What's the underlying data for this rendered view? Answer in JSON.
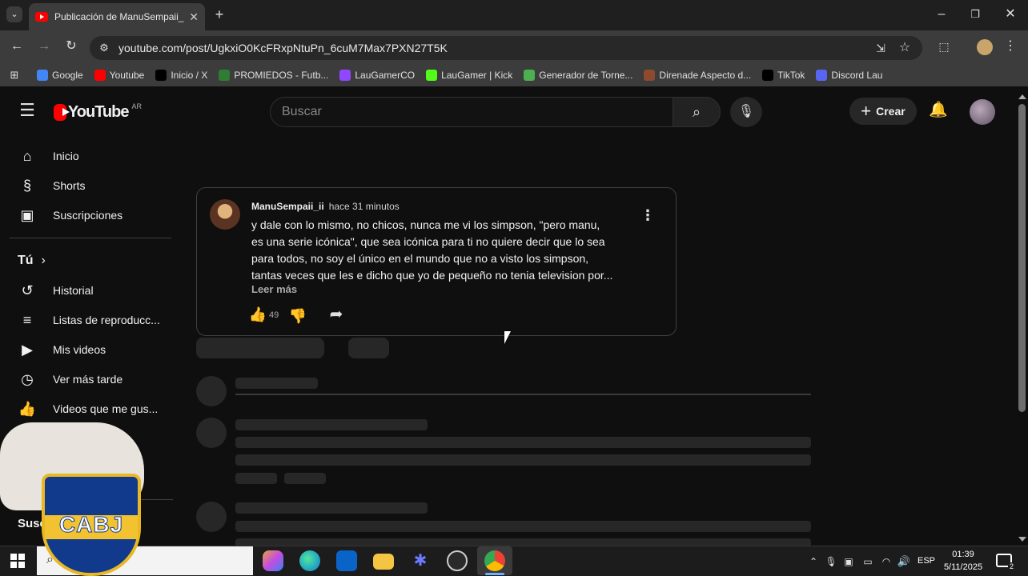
{
  "browser": {
    "tab_title": "Publicación de ManuSempaii_ii",
    "url": "youtube.com/post/UgkxiO0KcFRxpNtuPn_6cuM7Max7PXN27T5K",
    "bookmarks": [
      "Google",
      "Youtube",
      "Inicio / X",
      "PROMIEDOS - Futb...",
      "LauGamerCO",
      "LauGamer | Kick",
      "Generador de Torne...",
      "Direnade Aspecto d...",
      "TikTok",
      "Discord Lau"
    ],
    "bookmark_colors": [
      "#4285f4",
      "#ff0000",
      "#000000",
      "#2e7d32",
      "#9146ff",
      "#53fc18",
      "#4caf50",
      "#8d4a2e",
      "#000000",
      "#5865f2"
    ]
  },
  "youtube": {
    "logo_text": "YouTube",
    "country": "AR",
    "search_placeholder": "Buscar",
    "create_label": "Crear",
    "sidebar": {
      "main": [
        {
          "label": "Inicio",
          "icon": "home-icon",
          "glyph": "⌂"
        },
        {
          "label": "Shorts",
          "icon": "shorts-icon",
          "glyph": "§"
        },
        {
          "label": "Suscripciones",
          "icon": "subscriptions-icon",
          "glyph": "▣"
        }
      ],
      "you_header": "Tú",
      "you": [
        {
          "label": "Historial",
          "icon": "history-icon",
          "glyph": "↺"
        },
        {
          "label": "Listas de reproducc...",
          "icon": "playlists-icon",
          "glyph": "≡"
        },
        {
          "label": "Mis videos",
          "icon": "my-videos-icon",
          "glyph": "▶"
        },
        {
          "label": "Ver más tarde",
          "icon": "clock-icon",
          "glyph": "◷"
        },
        {
          "label": "Videos que me gus...",
          "icon": "like-icon",
          "glyph": "👍"
        }
      ],
      "subs_header": "Susc"
    },
    "post": {
      "author": "ManuSempaii_ii",
      "time": "hace 31 minutos",
      "lines": [
        "y dale con lo mismo, no chicos, nunca me vi los simpson, \"pero manu,",
        "es una serie icónica\", que sea icónica para ti no quiere decir que lo sea",
        "para todos, no soy el único en el mundo que no a visto los simpson,",
        "tantas veces que les e dicho que yo de pequeño no tenia television por..."
      ],
      "read_more": "Leer más",
      "likes": "49"
    }
  },
  "overlay": {
    "badge_text": "CABJ"
  },
  "taskbar": {
    "lang": "ESP",
    "time": "01:39",
    "date": "5/11/2025",
    "notifications": "2"
  }
}
